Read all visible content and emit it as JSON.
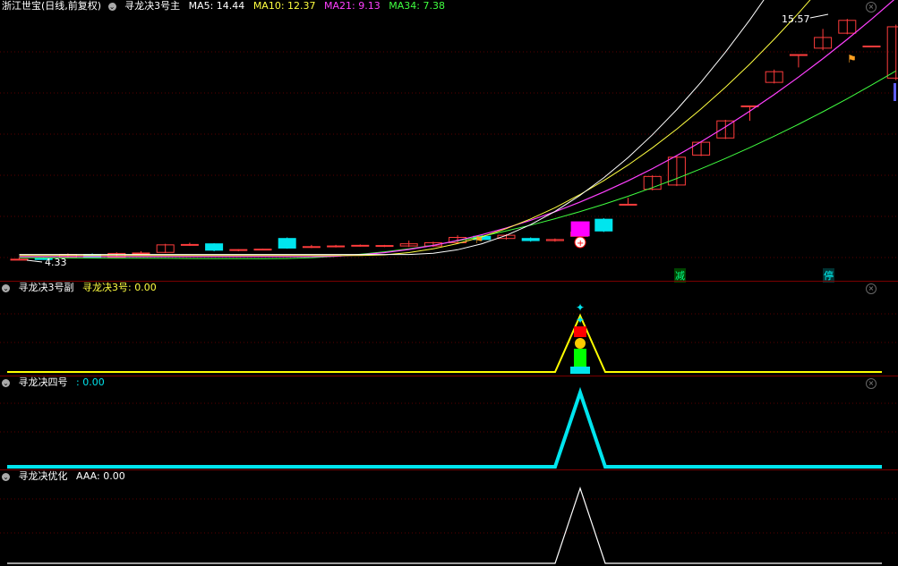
{
  "main_panel": {
    "stock_title": "浙江世宝(日线,前复权)",
    "indicator_name": "寻龙决3号主",
    "ma": [
      {
        "label": "MA5: 14.44",
        "color": "#ffffff"
      },
      {
        "label": "MA10: 12.37",
        "color": "#ffff40"
      },
      {
        "label": "MA21: 9.13",
        "color": "#ff40ff"
      },
      {
        "label": "MA34: 7.38",
        "color": "#40ff40"
      }
    ],
    "high_label": "15.57",
    "low_label": "4.33",
    "signals": [
      {
        "text": "减",
        "color": "#00ff88"
      },
      {
        "text": "停",
        "color": "#00ffff"
      }
    ],
    "candles": [
      {
        "o": 4.32,
        "c": 4.33,
        "h": 4.4,
        "l": 4.28,
        "up": true
      },
      {
        "o": 4.35,
        "c": 4.36,
        "h": 4.4,
        "l": 4.3,
        "up": false
      },
      {
        "o": 4.4,
        "c": 4.55,
        "h": 4.6,
        "l": 4.38,
        "up": true
      },
      {
        "o": 4.55,
        "c": 4.42,
        "h": 4.6,
        "l": 4.4,
        "up": false
      },
      {
        "o": 4.42,
        "c": 4.6,
        "h": 4.65,
        "l": 4.4,
        "up": true
      },
      {
        "o": 4.6,
        "c": 4.62,
        "h": 4.7,
        "l": 4.55,
        "up": true
      },
      {
        "o": 4.65,
        "c": 5.0,
        "h": 5.05,
        "l": 4.62,
        "up": true
      },
      {
        "o": 5.0,
        "c": 5.02,
        "h": 5.1,
        "l": 4.95,
        "up": true
      },
      {
        "o": 5.05,
        "c": 4.75,
        "h": 5.08,
        "l": 4.7,
        "up": false
      },
      {
        "o": 4.75,
        "c": 4.78,
        "h": 4.8,
        "l": 4.7,
        "up": true
      },
      {
        "o": 4.78,
        "c": 4.8,
        "h": 4.82,
        "l": 4.75,
        "up": true
      },
      {
        "o": 4.85,
        "c": 5.3,
        "h": 5.35,
        "l": 4.82,
        "up": false
      },
      {
        "o": 4.9,
        "c": 4.92,
        "h": 5.0,
        "l": 4.85,
        "up": true
      },
      {
        "o": 4.92,
        "c": 4.95,
        "h": 5.0,
        "l": 4.88,
        "up": true
      },
      {
        "o": 4.96,
        "c": 4.98,
        "h": 5.02,
        "l": 4.92,
        "up": true
      },
      {
        "o": 4.95,
        "c": 4.97,
        "h": 5.0,
        "l": 4.9,
        "up": true
      },
      {
        "o": 4.95,
        "c": 5.05,
        "h": 5.2,
        "l": 4.9,
        "up": true
      },
      {
        "o": 4.95,
        "c": 5.1,
        "h": 5.15,
        "l": 4.9,
        "up": true
      },
      {
        "o": 5.1,
        "c": 5.35,
        "h": 5.45,
        "l": 5.05,
        "up": true
      },
      {
        "o": 5.4,
        "c": 5.25,
        "h": 5.45,
        "l": 5.2,
        "up": false
      },
      {
        "o": 5.3,
        "c": 5.45,
        "h": 5.5,
        "l": 5.25,
        "up": true
      },
      {
        "o": 5.3,
        "c": 5.2,
        "h": 5.35,
        "l": 5.15,
        "up": false
      },
      {
        "o": 5.2,
        "c": 5.25,
        "h": 5.3,
        "l": 5.15,
        "up": true
      },
      {
        "o": 5.4,
        "c": 5.6,
        "h": 5.65,
        "l": 5.35,
        "up": true
      },
      {
        "o": 6.2,
        "c": 5.65,
        "h": 6.25,
        "l": 5.6,
        "up": false
      },
      {
        "o": 6.9,
        "c": 6.9,
        "h": 7.2,
        "l": 6.9,
        "up": true
      },
      {
        "o": 7.6,
        "c": 8.2,
        "h": 8.25,
        "l": 7.55,
        "up": true
      },
      {
        "o": 7.8,
        "c": 9.1,
        "h": 9.2,
        "l": 7.75,
        "up": true
      },
      {
        "o": 9.2,
        "c": 9.8,
        "h": 9.85,
        "l": 9.15,
        "up": true
      },
      {
        "o": 10.0,
        "c": 10.8,
        "h": 10.85,
        "l": 9.95,
        "up": true
      },
      {
        "o": 11.5,
        "c": 11.5,
        "h": 11.5,
        "l": 10.8,
        "up": true
      },
      {
        "o": 12.6,
        "c": 13.1,
        "h": 13.2,
        "l": 12.55,
        "up": true
      },
      {
        "o": 13.9,
        "c": 13.9,
        "h": 13.9,
        "l": 13.3,
        "up": true
      },
      {
        "o": 14.2,
        "c": 14.7,
        "h": 15.1,
        "l": 14.1,
        "up": true
      },
      {
        "o": 14.9,
        "c": 15.5,
        "h": 15.57,
        "l": 14.85,
        "up": true
      },
      {
        "o": 14.3,
        "c": 14.3,
        "h": 14.3,
        "l": 14.3,
        "up": true
      },
      {
        "o": 12.8,
        "c": 15.2,
        "h": 15.3,
        "l": 12.7,
        "up": true
      }
    ]
  },
  "panel2": {
    "name": "寻龙决3号副",
    "value_label": "寻龙决3号: 0.00"
  },
  "panel3": {
    "name": "寻龙决四号",
    "value_label": ": 0.00"
  },
  "panel4": {
    "name": "寻龙决优化",
    "value_label": "AAA: 0.00"
  },
  "colors": {
    "up": "#ff3c3c",
    "down": "#00e5ee",
    "grid": "#5a0000",
    "yellow": "#ffff00",
    "cyan": "#00e5ee",
    "white": "#ffffff"
  }
}
